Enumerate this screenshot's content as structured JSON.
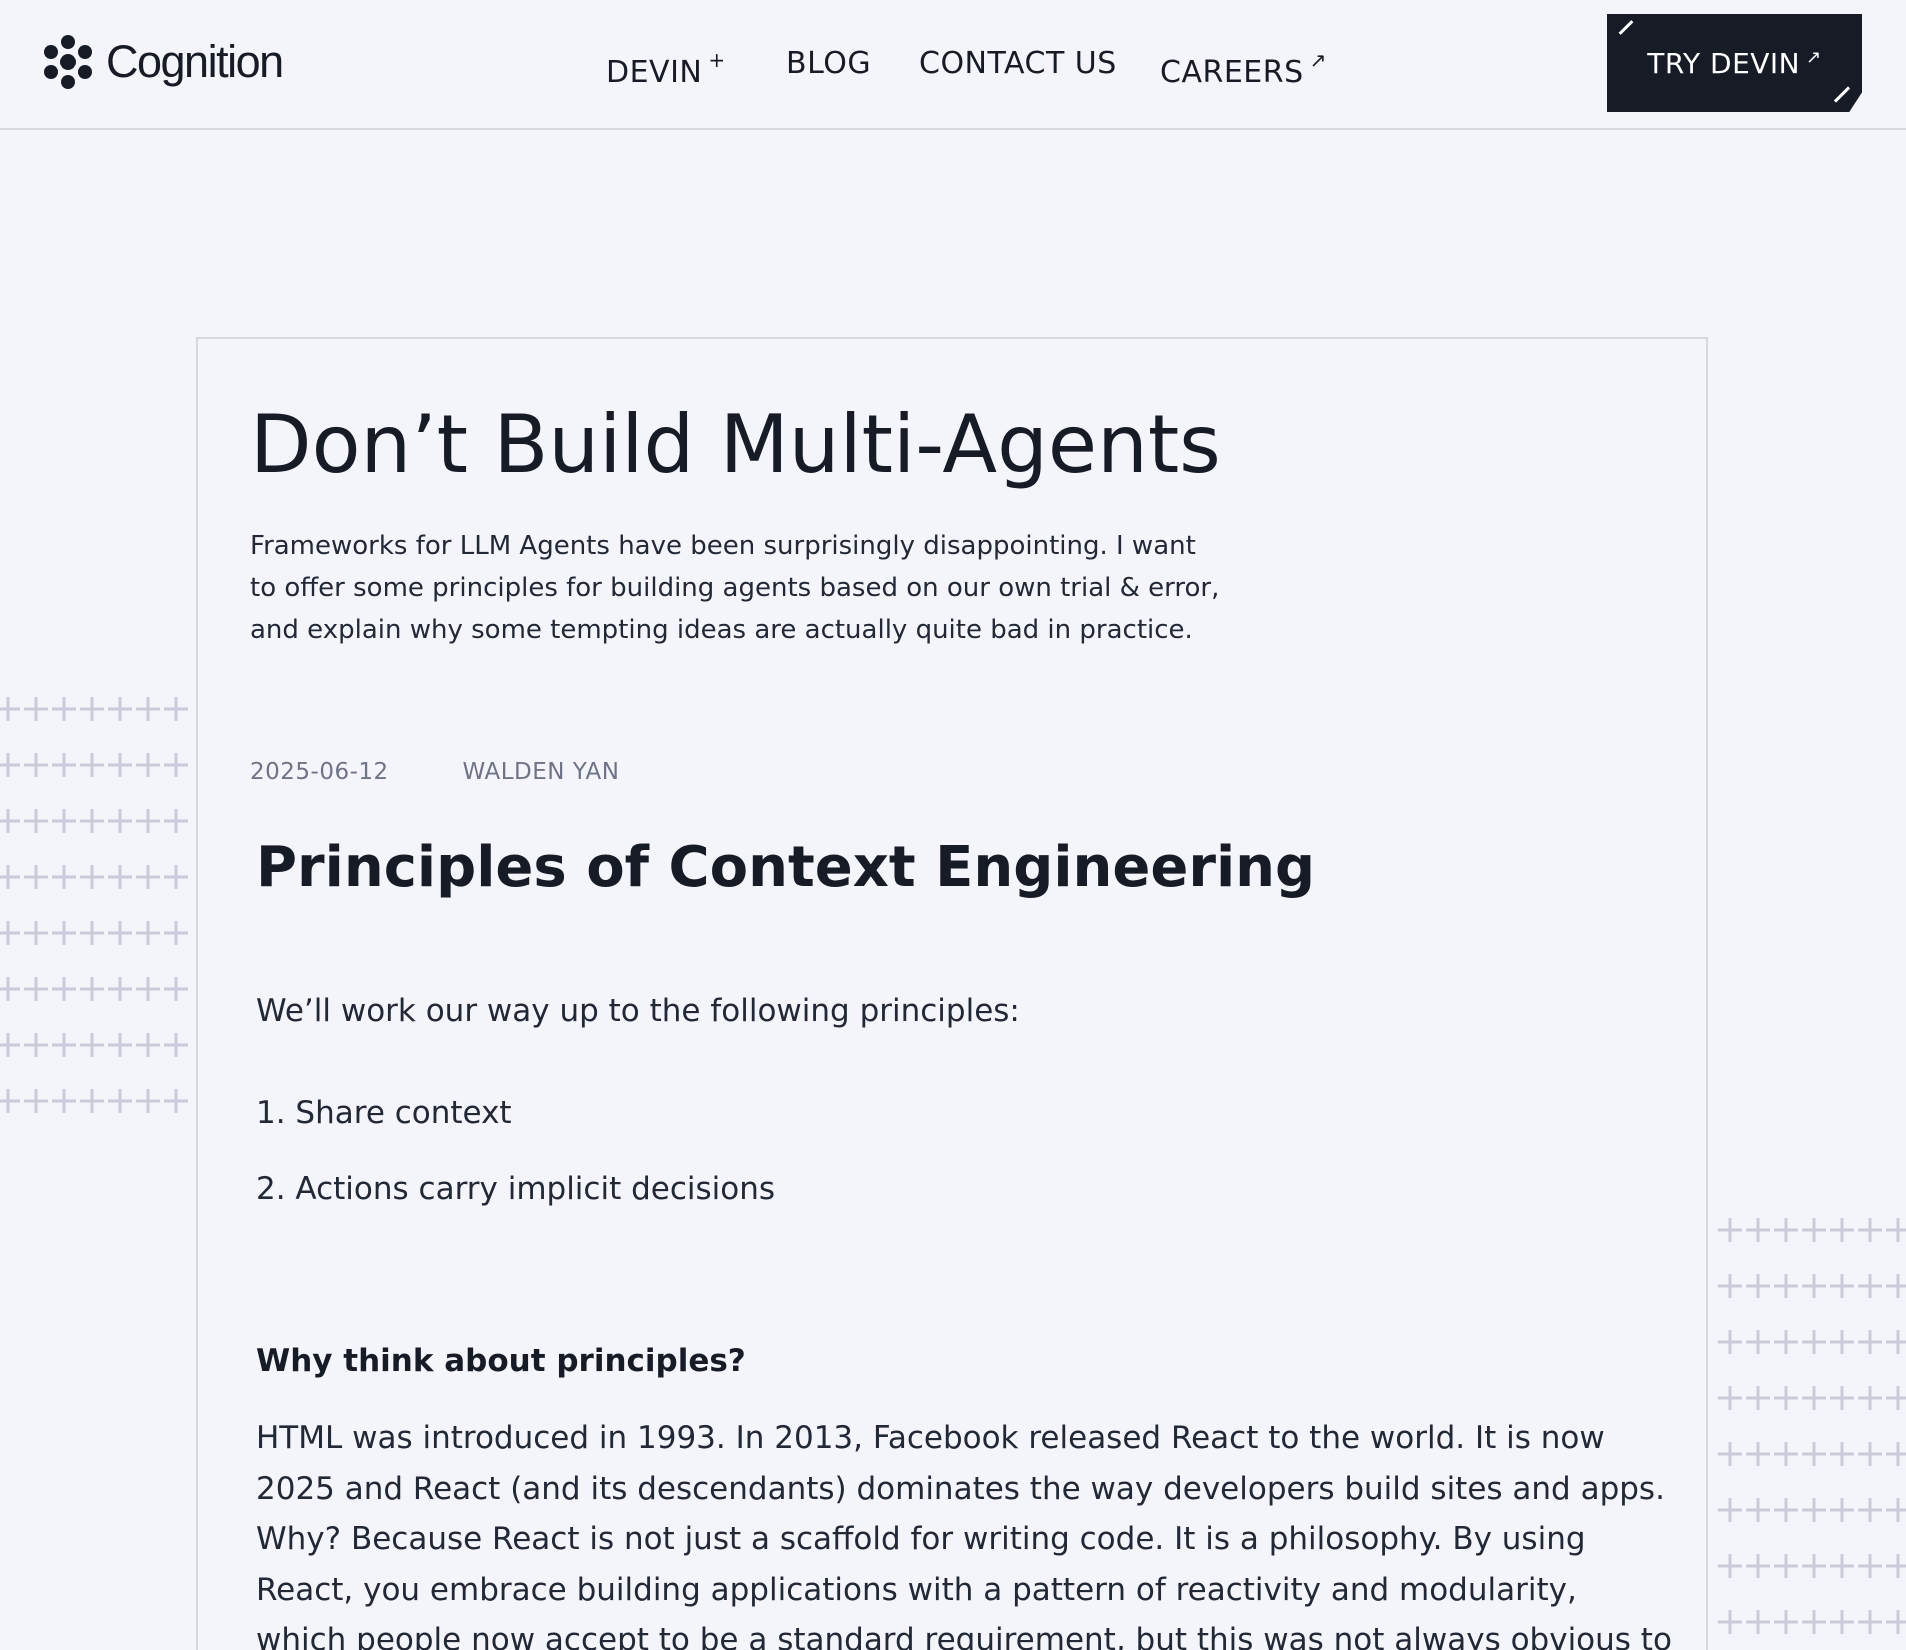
{
  "header": {
    "logo_text": "Cognition",
    "nav": [
      {
        "label": "DEVIN",
        "suffix": "+"
      },
      {
        "label": "BLOG",
        "suffix": ""
      },
      {
        "label": "CONTACT US",
        "suffix": ""
      },
      {
        "label": "CAREERS",
        "suffix": "↗"
      }
    ],
    "cta": {
      "label": "TRY DEVIN",
      "suffix": "↗"
    }
  },
  "article": {
    "title": "Don’t Build Multi-Agents",
    "subtitle": "Frameworks for LLM Agents have been surprisingly disappointing. I want to offer some principles for building agents based on our own trial & error, and explain why some tempting ideas are actually quite bad in practice.",
    "date": "2025-06-12",
    "author": "WALDEN YAN",
    "section_heading": "Principles of Context Engineering",
    "intro": "We’ll work our way up to the following principles:",
    "principles": [
      "1. Share context",
      "2. Actions carry implicit decisions"
    ],
    "subheading": "Why think about principles?",
    "body": "HTML was introduced in 1993. In 2013, Facebook released React to the world. It is now 2025 and React (and its descendants) dominates the way developers build sites and apps. Why? Because React is not just a scaffold for writing code. It is a philosophy. By using React, you embrace building applications with a pattern of reactivity and modularity, which people now accept to be a standard requirement, but this was not always obvious to early web"
  },
  "colors": {
    "background": "#f4f5fa",
    "text": "#161b26",
    "muted": "#6e7486",
    "border": "#d6d8e0",
    "pattern": "#c9cbdb"
  },
  "icons": {
    "logo": "cognition-hex-logo-icon",
    "nav_plus": "plus-icon",
    "external_arrow": "external-arrow-icon"
  }
}
